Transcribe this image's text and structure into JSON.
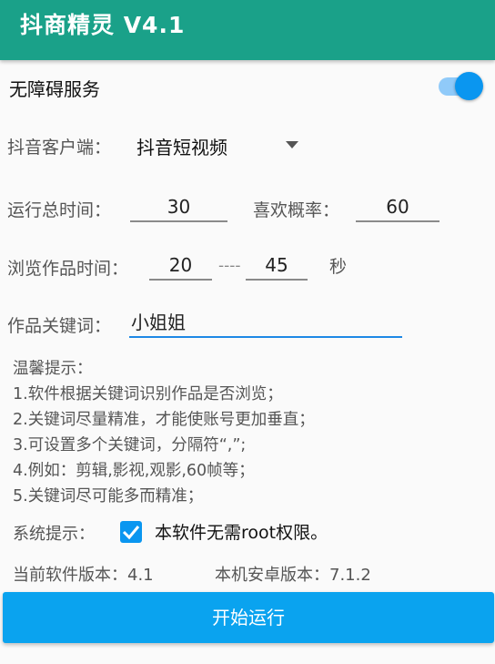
{
  "app_bar": {
    "title": "抖商精灵 V4.1"
  },
  "accessibility": {
    "label": "无障碍服务",
    "enabled": true
  },
  "client": {
    "label": "抖音客户端：",
    "selected": "抖音短视频"
  },
  "run": {
    "total_time_label": "运行总时间：",
    "total_time_value": "30",
    "like_prob_label": "喜欢概率：",
    "like_prob_value": "60"
  },
  "browse": {
    "label": "浏览作品时间：",
    "min": "20",
    "separator": "----",
    "max": "45",
    "unit": "秒"
  },
  "keyword": {
    "label": "作品关键词：",
    "value": "小姐姐"
  },
  "tips": {
    "title": "温馨提示：",
    "lines": [
      "1.软件根据关键词识别作品是否浏览；",
      "2.关键词尽量精准，才能使账号更加垂直；",
      "3.可设置多个关键词，分隔符“,”;",
      "4.例如：剪辑,影视,观影,60帧等；",
      "5.关键词尽可能多而精准；"
    ]
  },
  "system": {
    "label": "系统提示：",
    "checkbox_text": "本软件无需root权限。",
    "checked": true
  },
  "versions": {
    "software_label": "当前软件版本：4.1",
    "android_label": "本机安卓版本：7.1.2"
  },
  "start_button": {
    "label": "开始运行"
  },
  "colors": {
    "app_bar": "#1aa189",
    "accent": "#0a96f0",
    "button": "#0aa3ef"
  }
}
